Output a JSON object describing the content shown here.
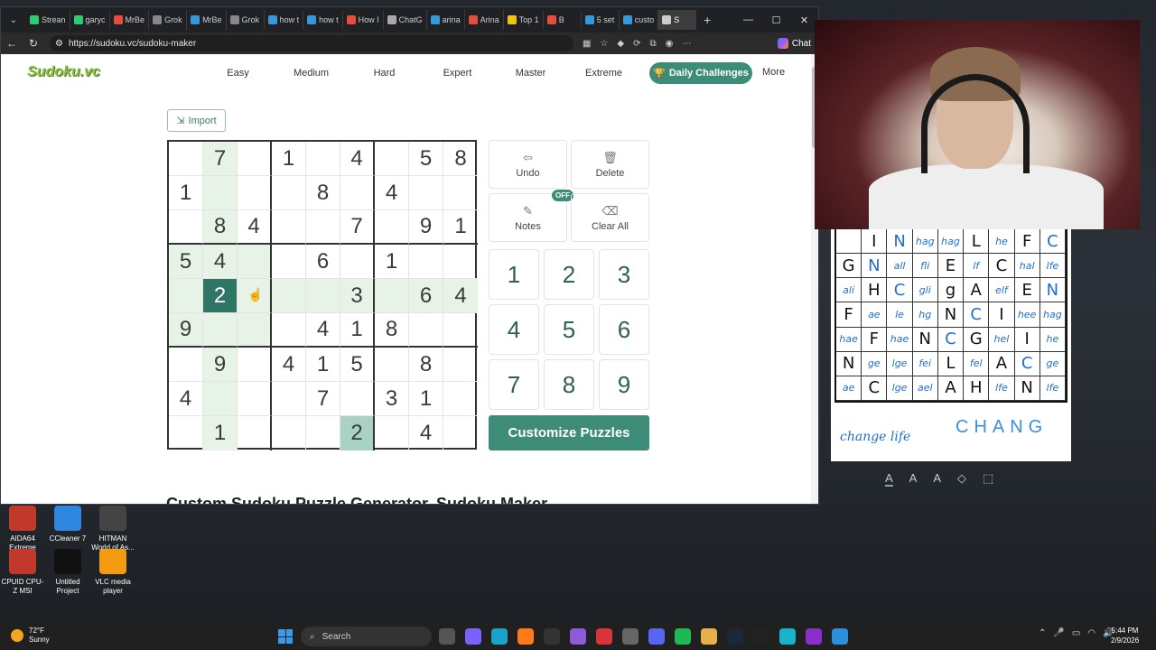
{
  "browser": {
    "tabs": [
      "Strean",
      "garyc",
      "MrBe",
      "Grok",
      "MrBe",
      "Grok",
      "how t",
      "how t",
      "How I",
      "ChatG",
      "arina",
      "Arina",
      "Top 1",
      "B",
      "5 set",
      "custo",
      "S"
    ],
    "url": "https://sudoku.vc/sudoku-maker",
    "chat_label": "Chat"
  },
  "site": {
    "logo": "Sudoku.vc",
    "nav": [
      "Easy",
      "Medium",
      "Hard",
      "Expert",
      "Master",
      "Extreme"
    ],
    "daily": "Daily Challenges",
    "more": "More",
    "import": "Import",
    "heading": "Custom Sudoku Puzzle Generator, Sudoku Maker"
  },
  "board": {
    "cells": [
      [
        "",
        "7",
        "",
        "1",
        "",
        "4",
        "",
        "5",
        "8"
      ],
      [
        "1",
        "",
        "",
        "",
        "8",
        "",
        "4",
        "",
        ""
      ],
      [
        "",
        "8",
        "4",
        "",
        "",
        "7",
        "",
        "9",
        "1"
      ],
      [
        "5",
        "4",
        "",
        "",
        "6",
        "",
        "1",
        "",
        ""
      ],
      [
        "",
        "2",
        "",
        "",
        "",
        "3",
        "",
        "6",
        "4"
      ],
      [
        "9",
        "",
        "",
        "",
        "4",
        "1",
        "8",
        "",
        ""
      ],
      [
        "",
        "9",
        "",
        "4",
        "1",
        "5",
        "",
        "8",
        ""
      ],
      [
        "4",
        "",
        "",
        "",
        "7",
        "",
        "3",
        "1",
        ""
      ],
      [
        "",
        "1",
        "",
        "",
        "",
        "2",
        "",
        "4",
        ""
      ]
    ],
    "selected": [
      4,
      1
    ],
    "same_value_highlight": [
      8,
      5
    ]
  },
  "controls": {
    "undo": "Undo",
    "delete": "Delete",
    "notes": "Notes",
    "notes_badge": "OFF",
    "clear_all": "Clear All",
    "numbers": [
      "1",
      "2",
      "3",
      "4",
      "5",
      "6",
      "7",
      "8",
      "9"
    ],
    "customize": "Customize Puzzles"
  },
  "paper": {
    "rows": [
      [
        "",
        "I",
        "N",
        "hag",
        "hag",
        "L",
        "he",
        "F",
        "C"
      ],
      [
        "G",
        "N",
        "all",
        "fli",
        "E",
        "lf",
        "C",
        "hal",
        "lfe"
      ],
      [
        "ali",
        "H",
        "C",
        "gli",
        "g",
        "A",
        "elf",
        "E",
        "N"
      ],
      [
        "F",
        "ae",
        "le",
        "hg",
        "N",
        "C",
        "I",
        "hee",
        "hag"
      ],
      [
        "hae",
        "F",
        "hae",
        "N",
        "C",
        "G",
        "hel",
        "I",
        "he"
      ],
      [
        "N",
        "ge",
        "lge",
        "fei",
        "L",
        "fel",
        "A",
        "C",
        "ge"
      ],
      [
        "ae",
        "C",
        "lge",
        "ael",
        "A",
        "H",
        "lfe",
        "N",
        "lfe"
      ]
    ],
    "note": "change life",
    "big_text": "CHANG"
  },
  "desktop": {
    "icons": [
      {
        "label": "AIDA64 Extreme",
        "color": "#c0392b"
      },
      {
        "label": "CCleaner 7",
        "color": "#2e86de"
      },
      {
        "label": "HITMAN World of As...",
        "color": "#444"
      }
    ],
    "icons2": [
      {
        "label": "CPUID CPU-Z MSI",
        "color": "#c0392b"
      },
      {
        "label": "Untitled Project",
        "color": "#111"
      },
      {
        "label": "VLC media player",
        "color": "#f39c12"
      }
    ]
  },
  "taskbar": {
    "temp": "72°F",
    "weather": "Sunny",
    "search": "Search",
    "time": "5:44 PM",
    "date": "2/9/2026"
  }
}
